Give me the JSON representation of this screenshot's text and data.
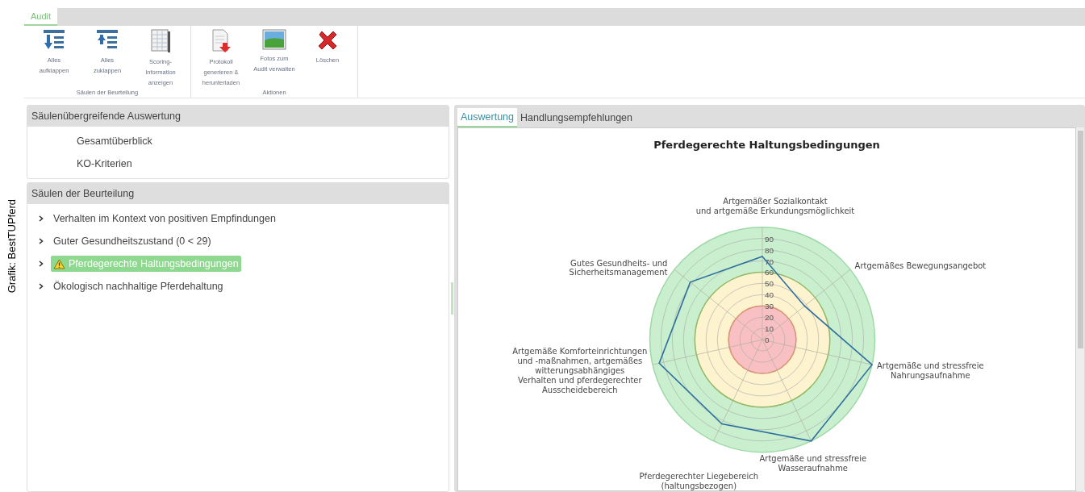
{
  "credit": "Grafik: BestTUPferd",
  "ribbon": {
    "tabs": [
      {
        "label": "Audit",
        "selected": true
      }
    ],
    "groups": [
      {
        "label": "Säulen der Beurteilung",
        "buttons": [
          {
            "kind": "expand",
            "label": "Alles aufklappen"
          },
          {
            "kind": "collapse",
            "label": "Alles zuklappen"
          },
          {
            "kind": "sheet",
            "label": "Scoring-Information anzeigen"
          }
        ]
      },
      {
        "label": "Aktionen",
        "buttons": [
          {
            "kind": "pdf",
            "label": "Protokoll generieren & herunterladen"
          },
          {
            "kind": "photo",
            "label": "Fotos zum Audit verwalten"
          },
          {
            "kind": "delete",
            "label": "Löschen"
          }
        ]
      }
    ]
  },
  "sections": [
    {
      "title": "Säulenübergreifende Auswertung",
      "items": [
        {
          "label": "Gesamtüberblick",
          "expandable": false,
          "selected": false,
          "warning": false
        },
        {
          "label": "KO-Kriterien",
          "expandable": false,
          "selected": false,
          "warning": false
        }
      ]
    },
    {
      "title": "Säulen der Beurteilung",
      "items": [
        {
          "label": "Verhalten im Kontext von positiven Empfindungen",
          "expandable": true,
          "selected": false,
          "warning": false
        },
        {
          "label": "Guter Gesundheitszustand (0 < 29)",
          "expandable": true,
          "selected": false,
          "warning": false
        },
        {
          "label": "Pferdegerechte Haltungsbedingungen",
          "expandable": true,
          "selected": true,
          "warning": true
        },
        {
          "label": "Ökologisch nachhaltige Pferdehaltung",
          "expandable": true,
          "selected": false,
          "warning": false
        }
      ]
    }
  ],
  "content_tabs": [
    {
      "label": "Auswertung",
      "selected": true
    },
    {
      "label": "Handlungsempfehlungen",
      "selected": false
    }
  ],
  "radar": {
    "title": "Pferdegerechte Haltungsbedingungen",
    "ticks": [
      "90",
      "80",
      "70",
      "60",
      "50",
      "40",
      "30",
      "20",
      "10",
      "0"
    ],
    "zones": [
      {
        "color": "#c9efcf"
      },
      {
        "color": "#fdf3cf"
      },
      {
        "color": "#f9c0c4"
      }
    ],
    "axes": [
      {
        "label": [
          "Artgemäßer Sozialkontakt",
          "und artgemäße Erkundungsmöglichkeit"
        ]
      },
      {
        "label": [
          "Artgemäßes Bewegungsangebot"
        ]
      },
      {
        "label": [
          "Artgemäße und stressfreie",
          "Nahrungsaufnahme"
        ]
      },
      {
        "label": [
          "Artgemäße und stressfreie",
          "Wasseraufnahme"
        ]
      },
      {
        "label": [
          "Pferdegerechter Liegebereich",
          "(haltungsbezogen)"
        ]
      },
      {
        "label": [
          "Artgemäße Komforteinrichtungen",
          "und -maßnahmen, artgemäßes",
          "witterungsabhängiges",
          "Verhalten und pferdegerechter",
          "Ausscheidebereich"
        ]
      },
      {
        "label": [
          "Gutes Gesundheits- und",
          "Sicherheitsmanagement"
        ]
      }
    ]
  }
}
